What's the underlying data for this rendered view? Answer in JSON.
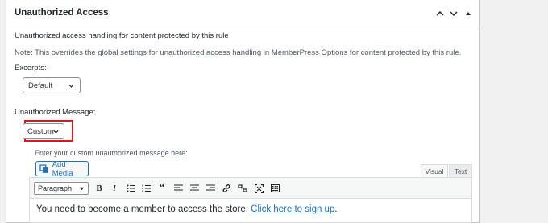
{
  "panel": {
    "title": "Unauthorized Access",
    "controls": [
      "chevron-up-icon",
      "chevron-down-icon",
      "triangle-up-icon"
    ]
  },
  "section": {
    "description": "Unauthorized access handling for content protected by this rule",
    "note": "Note: This overrides the global settings for unauthorized access handling in MemberPress Options for content protected by this rule."
  },
  "excerpts": {
    "label": "Excerpts:",
    "selected": "Default"
  },
  "message": {
    "label": "Unauthorized Message:",
    "selected": "Custom",
    "hint": "Enter your custom unauthorized message here:"
  },
  "editor": {
    "add_media": "Add Media",
    "tabs": [
      "Visual",
      "Text"
    ],
    "format": "Paragraph",
    "toolbar_icons": [
      "bold-icon",
      "italic-icon",
      "bulleted-list-icon",
      "numbered-list-icon",
      "blockquote-icon",
      "align-left-icon",
      "align-center-icon",
      "align-right-icon",
      "link-icon",
      "unlink-icon",
      "fullscreen-icon",
      "toolbar-toggle-icon"
    ],
    "content_text": "You need to become a member to access the store. ",
    "content_link": "Click here to sign up",
    "content_tail": "."
  },
  "colors": {
    "highlight": "#e1141b",
    "link": "#2271b1"
  }
}
